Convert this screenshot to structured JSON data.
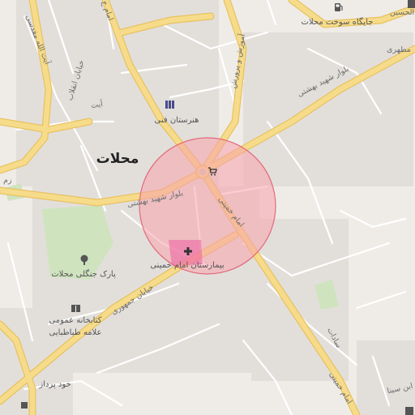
{
  "map": {
    "city_label": "محلات",
    "colors": {
      "background": "#efece8",
      "block": "#e2dfdb",
      "major_road": "#f6dc8a",
      "major_road_edge": "#e8c262",
      "minor_road": "#ffffff",
      "park": "#cfe3bf",
      "radius_fill": "#f7a3ab",
      "radius_stroke": "#e36b79",
      "hospital": "#ef5fa2"
    },
    "streets": [
      {
        "key": "beheshti_w",
        "text": "بلوار شهید بهشتی"
      },
      {
        "key": "beheshti_ne",
        "text": "بلوار شهید بهشتی"
      },
      {
        "key": "khomeini",
        "text": "امام خمینی"
      },
      {
        "key": "jomhouri",
        "text": "خیابان جمهوری"
      },
      {
        "key": "enghelab",
        "text": "خیابان انقلاب"
      },
      {
        "key": "ayatollah",
        "text": "آیت الله مقدسی"
      },
      {
        "key": "imam_n",
        "text": "امام خ"
      },
      {
        "key": "ayat",
        "text": "آیت"
      },
      {
        "key": "amoozesh",
        "text": "آموزش و پرورش"
      },
      {
        "key": "motahari",
        "text": "مطهری"
      },
      {
        "key": "sadat",
        "text": "سادات"
      },
      {
        "key": "imam_s",
        "text": "امام خمینی"
      },
      {
        "key": "hosein",
        "text": "الحسین"
      },
      {
        "key": "sina",
        "text": "ابن سینا"
      },
      {
        "key": "zam",
        "text": "زم"
      }
    ],
    "pois": [
      {
        "key": "gas",
        "text": "جایگاه سوخت محلات",
        "icon": "fuel-icon"
      },
      {
        "key": "art",
        "text": "هنرستان فنی",
        "icon": "school-icon"
      },
      {
        "key": "hospital",
        "text": "بیمارستان امام خمینی",
        "icon": "hospital-cross-icon"
      },
      {
        "key": "park",
        "text": "پارک جنگلی محلات",
        "icon": "tree-icon"
      },
      {
        "key": "library1",
        "text": "کتابخانه عمومی",
        "icon": "book-icon"
      },
      {
        "key": "library2",
        "text": "علامه طباطبایی",
        "icon": "none"
      },
      {
        "key": "khodpardaz",
        "text": "خود پرداز",
        "icon": "none"
      },
      {
        "key": "shop",
        "text": "",
        "icon": "cart-icon"
      }
    ]
  }
}
